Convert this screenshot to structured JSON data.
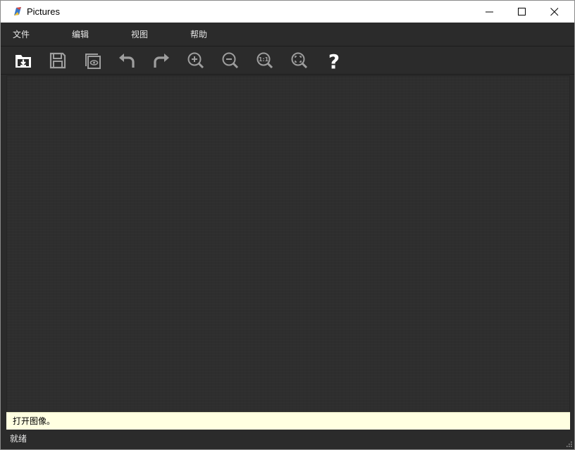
{
  "window": {
    "title": "Pictures",
    "controls": [
      "minimize-icon",
      "maximize-icon",
      "close-icon"
    ]
  },
  "menu": {
    "file": "文件",
    "edit": "编辑",
    "view": "视图",
    "help": "帮助"
  },
  "toolbar": {
    "tools": [
      {
        "name": "open-icon",
        "tooltip": "打开图像。"
      },
      {
        "name": "save-icon"
      },
      {
        "name": "preview-icon"
      },
      {
        "name": "undo-icon"
      },
      {
        "name": "redo-icon"
      },
      {
        "name": "zoom-in-icon"
      },
      {
        "name": "zoom-out-icon"
      },
      {
        "name": "actual-size-icon",
        "label": "1:1"
      },
      {
        "name": "fit-window-icon"
      },
      {
        "name": "help-icon",
        "label": "?"
      }
    ]
  },
  "message": {
    "text": "打开图像。"
  },
  "status": {
    "text": "就绪"
  },
  "colors": {
    "chrome": "#2b2b2b",
    "canvas": "#2e2e2e",
    "tooltip": "#ffffe1",
    "icon": "#bdbdbd",
    "icon_active": "#ffffff"
  }
}
